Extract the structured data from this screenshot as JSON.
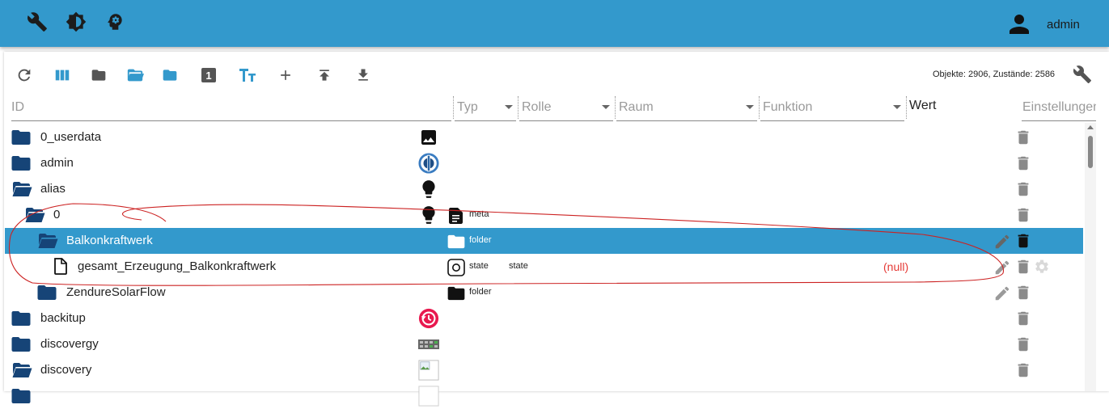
{
  "header": {
    "user_name": "admin"
  },
  "toolbar": {
    "stats": "Objekte: 2906, Zustände: 2586",
    "settings_icon": "wrench-icon",
    "number_badge": "1",
    "text_size_label": "TT"
  },
  "columns": {
    "id": "ID",
    "type": "Typ",
    "role": "Rolle",
    "room": "Raum",
    "function": "Funktion",
    "value": "Wert",
    "settings": "Einstellungen"
  },
  "rows": [
    {
      "name": "0_userdata",
      "type": "",
      "role": "",
      "value": ""
    },
    {
      "name": "admin",
      "type": "",
      "role": "",
      "value": ""
    },
    {
      "name": "alias",
      "type": "",
      "role": "",
      "value": ""
    },
    {
      "name": "0",
      "type": "meta",
      "role": "",
      "value": ""
    },
    {
      "name": "Balkonkraftwerk",
      "type": "folder",
      "role": "",
      "value": ""
    },
    {
      "name": "gesamt_Erzeugung_Balkonkraftwerk",
      "type": "state",
      "role": "state",
      "value": "(null)"
    },
    {
      "name": "ZendureSolarFlow",
      "type": "folder",
      "role": "",
      "value": ""
    },
    {
      "name": "backitup",
      "type": "",
      "role": "",
      "value": ""
    },
    {
      "name": "discovergy",
      "type": "",
      "role": "",
      "value": ""
    },
    {
      "name": "discovery",
      "type": "",
      "role": "",
      "value": ""
    }
  ],
  "colors": {
    "accent": "#3399cc",
    "folder": "#164477",
    "null_value": "#e53935",
    "annotation": "#cc2222"
  }
}
